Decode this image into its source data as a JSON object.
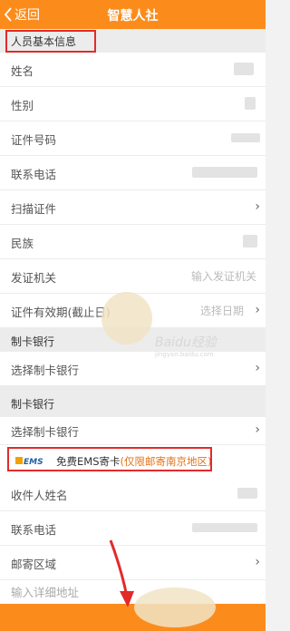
{
  "header": {
    "back_label": "返回",
    "title": "智慧人社"
  },
  "personal": {
    "section_title": "人员基本信息",
    "fields": [
      {
        "label": "姓名",
        "value": ""
      },
      {
        "label": "性别",
        "value": ""
      },
      {
        "label": "证件号码",
        "value": ""
      },
      {
        "label": "联系电话",
        "value": ""
      },
      {
        "label": "扫描证件",
        "value": ""
      },
      {
        "label": "民族",
        "value": ""
      },
      {
        "label": "发证机关",
        "value": "输入发证机关"
      },
      {
        "label": "证件有效期(截止日)",
        "value": "选择日期"
      }
    ]
  },
  "bank_section_1": {
    "title": "制卡银行",
    "select_label": "选择制卡银行"
  },
  "bank_section_2": {
    "title": "制卡银行",
    "select_label": "选择制卡银行"
  },
  "ems": {
    "logo_text": "EMS",
    "title": "免费EMS寄卡",
    "note": "(仅限邮寄南京地区)"
  },
  "mail_fields": [
    {
      "label": "收件人姓名"
    },
    {
      "label": "联系电话"
    },
    {
      "label": "邮寄区域"
    },
    {
      "label": "输入详细地址"
    }
  ],
  "watermark": {
    "text": "Baidu经验",
    "sub": "jingyan.baidu.com"
  },
  "colors": {
    "accent": "#fb8c1c",
    "highlight": "#e12b2b",
    "ems_note": "#e4731a"
  }
}
